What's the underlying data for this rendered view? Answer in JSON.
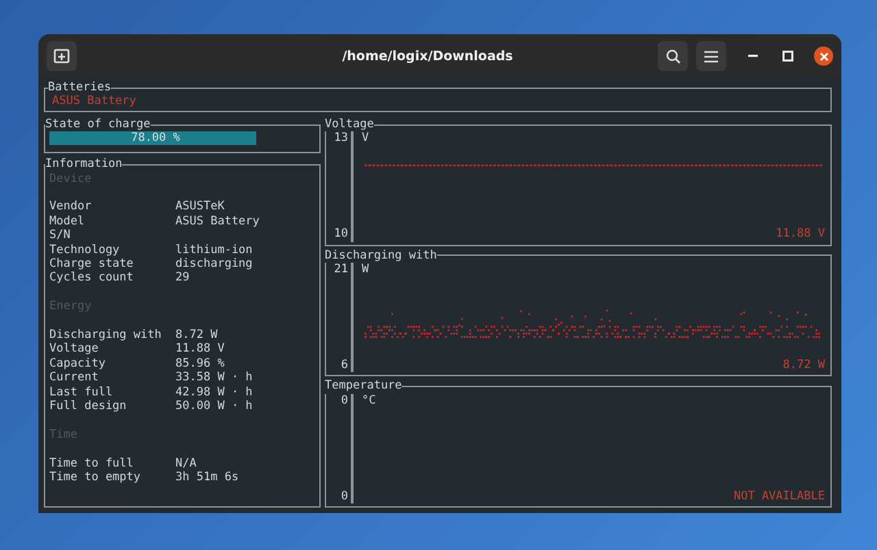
{
  "window": {
    "title": "/home/logix/Downloads"
  },
  "batteries": {
    "title": "Batteries",
    "items": [
      "ASUS Battery"
    ]
  },
  "state_of_charge": {
    "title": "State of charge",
    "level": 0.78,
    "reading": "78.00 %"
  },
  "information": {
    "title": "Information",
    "sections": [
      {
        "heading": "Device",
        "rows": [
          {
            "label": "Vendor",
            "value": "ASUSTeK"
          },
          {
            "label": "Model",
            "value": "ASUS Battery"
          },
          {
            "label": "S/N"
          },
          {
            "label": "Technology",
            "value": "lithium-ion"
          },
          {
            "label": "Charge state",
            "value": "discharging"
          },
          {
            "label": "Cycles count",
            "value": "29"
          }
        ]
      },
      {
        "heading": "Energy",
        "rows": [
          {
            "label": "Discharging with",
            "value": "8.72 W"
          },
          {
            "label": "Voltage",
            "value": "11.88 V"
          },
          {
            "label": "Capacity",
            "value": "85.96 %"
          },
          {
            "label": "Current",
            "value": "33.58 W · h"
          },
          {
            "label": "Last full",
            "value": "42.98 W · h"
          },
          {
            "label": "Full design",
            "value": "50.00 W · h"
          }
        ]
      },
      {
        "heading": "Time",
        "rows": [
          {
            "label": "Time to full",
            "value": "N/A"
          },
          {
            "label": "Time to empty",
            "value": "3h 51m 6s"
          }
        ]
      }
    ]
  },
  "graphs": [
    {
      "kind": "line",
      "title": "Voltage",
      "y_max": "13",
      "y_min": "10",
      "unit": "V",
      "reading": "11.88 V"
    },
    {
      "kind": "scatter",
      "title": "Discharging with",
      "y_max": "21",
      "y_min": "6",
      "unit": "W",
      "reading": "8.72 W"
    },
    {
      "kind": "empty",
      "title": "Temperature",
      "y_max": "0",
      "y_min": "0",
      "unit": "°C",
      "reading": "NOT AVAILABLE"
    }
  ]
}
